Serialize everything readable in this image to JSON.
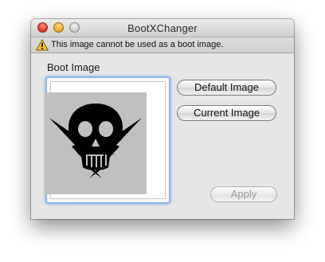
{
  "window": {
    "title": "BootXChanger"
  },
  "alert": {
    "message": "This image cannot be used as a boot image.",
    "icon": "warning-icon"
  },
  "boot_image": {
    "label": "Boot Image",
    "icon": "skull-lightning-icon"
  },
  "buttons": {
    "default_image": "Default Image",
    "current_image": "Current Image",
    "apply": "Apply"
  },
  "colors": {
    "close": "#e2352b",
    "minimize": "#f0a928",
    "zoom_disabled": "#cfcfcf",
    "focus_ring": "#8fb6e6",
    "image_background": "#c0c0c0",
    "disabled_text": "#9a9a9a"
  }
}
